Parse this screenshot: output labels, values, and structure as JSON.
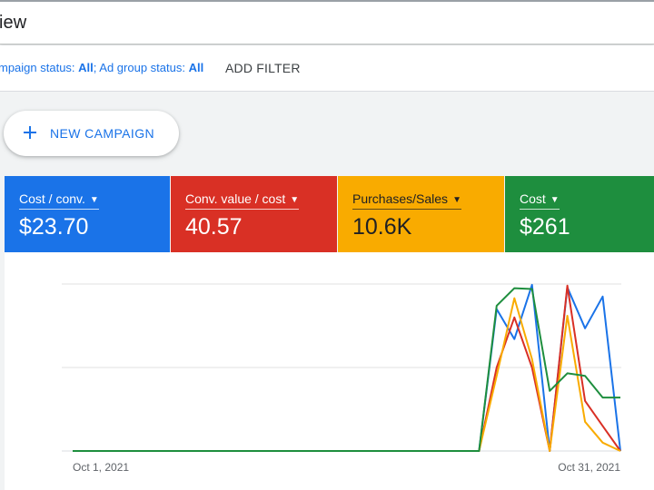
{
  "header": {
    "title": "iew"
  },
  "filters": {
    "campaign_status_label": "mpaign status: ",
    "campaign_status_value": "All",
    "separator": "; ",
    "ad_group_status_label": "Ad group status: ",
    "ad_group_status_value": "All",
    "add_filter": "ADD FILTER"
  },
  "new_campaign": {
    "icon": "plus-icon",
    "label": "NEW CAMPAIGN"
  },
  "metrics": [
    {
      "label": "Cost / conv.",
      "value": "$23.70",
      "color": "#1a73e8"
    },
    {
      "label": "Conv. value / cost",
      "value": "40.57",
      "color": "#d93025"
    },
    {
      "label": "Purchases/Sales",
      "value": "10.6K",
      "color": "#f9ab00"
    },
    {
      "label": "Cost",
      "value": "$261",
      "color": "#1e8e3e"
    }
  ],
  "chart_data": {
    "type": "line",
    "x_tick_labels": [
      "Oct 1, 2021",
      "Oct 31, 2021"
    ],
    "y_range": [
      0,
      2
    ],
    "grid": true,
    "series": [
      {
        "color": "#1a73e8",
        "values": [
          0,
          0,
          0,
          0,
          0,
          0,
          0,
          0,
          0,
          0,
          0,
          0,
          0,
          0,
          0,
          0,
          0,
          0,
          0,
          0,
          0,
          0,
          0,
          0,
          1.7,
          1.34,
          1.99,
          0,
          1.96,
          1.47,
          1.85,
          0
        ]
      },
      {
        "color": "#d93025",
        "values": [
          0,
          0,
          0,
          0,
          0,
          0,
          0,
          0,
          0,
          0,
          0,
          0,
          0,
          0,
          0,
          0,
          0,
          0,
          0,
          0,
          0,
          0,
          0,
          0,
          1.0,
          1.6,
          1.0,
          0,
          1.98,
          0.6,
          0.3,
          0
        ]
      },
      {
        "color": "#f9ab00",
        "values": [
          0,
          0,
          0,
          0,
          0,
          0,
          0,
          0,
          0,
          0,
          0,
          0,
          0,
          0,
          0,
          0,
          0,
          0,
          0,
          0,
          0,
          0,
          0,
          0,
          0.9,
          1.83,
          1.1,
          0,
          1.62,
          0.35,
          0.1,
          0
        ]
      },
      {
        "color": "#1e8e3e",
        "values": [
          0,
          0,
          0,
          0,
          0,
          0,
          0,
          0,
          0,
          0,
          0,
          0,
          0,
          0,
          0,
          0,
          0,
          0,
          0,
          0,
          0,
          0,
          0,
          0,
          1.74,
          1.95,
          1.94,
          0.72,
          0.93,
          0.9,
          0.64,
          0.64
        ]
      }
    ]
  }
}
